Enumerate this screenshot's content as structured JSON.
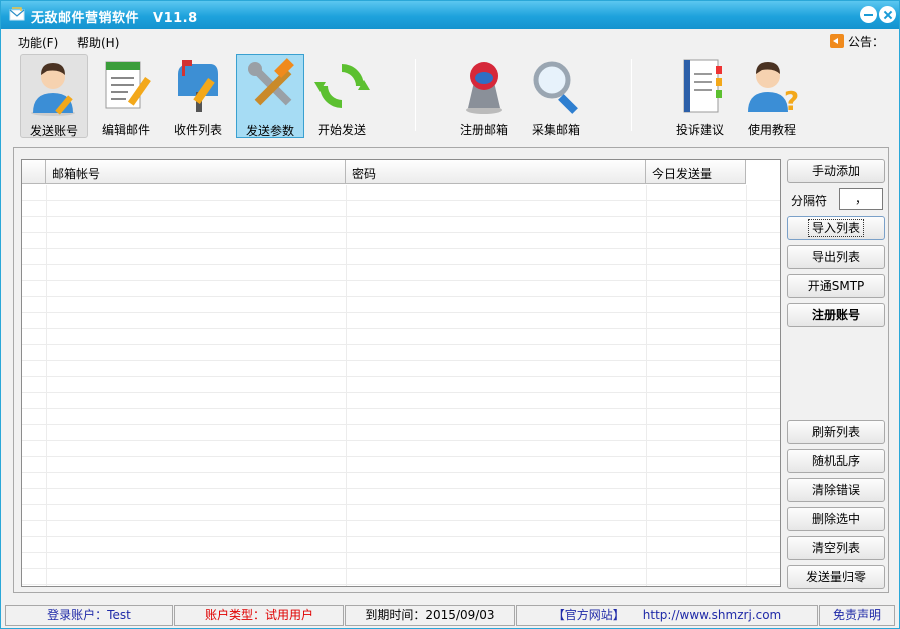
{
  "window": {
    "title": "无敌邮件营销软件",
    "version": "V11.8"
  },
  "menu": {
    "function": "功能(F)",
    "help": "帮助(H)",
    "notice": "公告："
  },
  "toolbar": {
    "send_account": "发送账号",
    "edit_mail": "编辑邮件",
    "recipient_list": "收件列表",
    "send_params": "发送参数",
    "start_send": "开始发送",
    "register_mail": "注册邮箱",
    "collect_mail": "采集邮箱",
    "feedback": "投诉建议",
    "tutorial": "使用教程"
  },
  "grid": {
    "columns": [
      "",
      "邮箱帐号",
      "密码",
      "今日发送量"
    ],
    "rows": []
  },
  "side": {
    "manual_add": "手动添加",
    "separator_label": "分隔符",
    "separator_value": "，",
    "import_list": "导入列表",
    "export_list": "导出列表",
    "open_smtp": "开通SMTP",
    "register_account": "注册账号",
    "refresh_list": "刷新列表",
    "shuffle": "随机乱序",
    "clear_errors": "清除错误",
    "delete_selected": "删除选中",
    "clear_list": "清空列表",
    "reset_count": "发送量归零"
  },
  "status": {
    "login": "登录账户：Test",
    "account_type": "账户类型：试用用户",
    "expire": "到期时间：2015/09/03",
    "site_label": "【官方网站】",
    "site_url": "http://www.shmzrj.com",
    "disclaimer": "免责声明"
  },
  "colors": {
    "title_bar": "#1ea2dc",
    "active_tool": "#a6dcf4",
    "status_blue": "#1f2aa8",
    "status_red": "#e00000"
  },
  "icons": [
    "mail-app-icon",
    "user-pencil-icon",
    "document-pencil-icon",
    "mailbox-icon",
    "tools-icon",
    "refresh-arrows-icon",
    "register-mail-icon",
    "magnifier-icon",
    "notebook-icon",
    "user-question-icon",
    "speaker-icon"
  ]
}
